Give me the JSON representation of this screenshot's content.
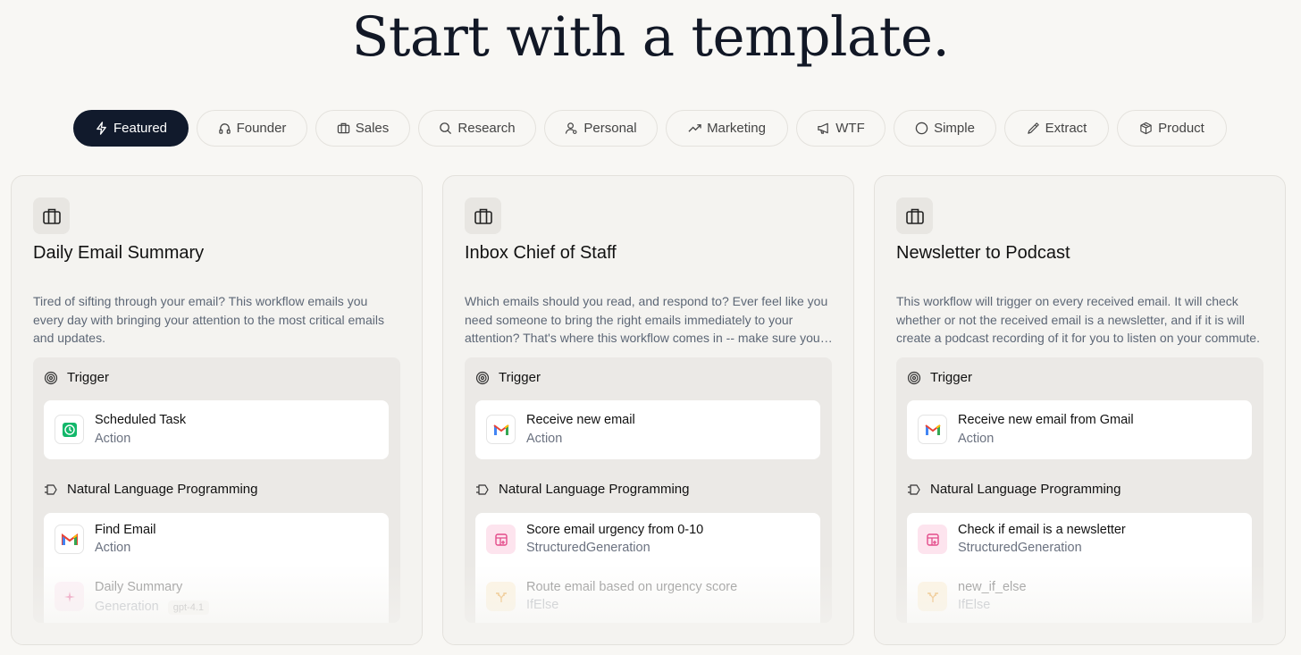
{
  "page": {
    "title": "Start with a template."
  },
  "tabs": [
    {
      "label": "Featured",
      "icon": "lightning-icon",
      "active": true
    },
    {
      "label": "Founder",
      "icon": "headphones-icon"
    },
    {
      "label": "Sales",
      "icon": "briefcase-icon"
    },
    {
      "label": "Research",
      "icon": "search-icon"
    },
    {
      "label": "Personal",
      "icon": "user-icon"
    },
    {
      "label": "Marketing",
      "icon": "trend-icon"
    },
    {
      "label": "WTF",
      "icon": "megaphone-icon"
    },
    {
      "label": "Simple",
      "icon": "circle-icon"
    },
    {
      "label": "Extract",
      "icon": "pipette-icon"
    },
    {
      "label": "Product",
      "icon": "box-icon"
    }
  ],
  "cards": [
    {
      "title": "Daily Email Summary",
      "description": "Tired of sifting through your email? This workflow emails you every day with bringing your attention to the most critical emails and updates.",
      "trigger_label": "Trigger",
      "trigger": {
        "name": "Scheduled Task",
        "type": "Action",
        "icon": "clock-icon"
      },
      "nlp_label": "Natural Language Programming",
      "steps": [
        {
          "name": "Find Email",
          "type": "Action",
          "icon": "gmail-icon"
        },
        {
          "name": "Daily Summary",
          "type": "Generation",
          "badge": "gpt-4.1",
          "icon": "sparkle-icon"
        }
      ]
    },
    {
      "title": "Inbox Chief of Staff",
      "description": "Which emails should you read, and respond to? Ever feel like you need someone to bring the right emails immediately to your attention? That's where this workflow comes in -- make sure you never miss an important email again.",
      "trigger_label": "Trigger",
      "trigger": {
        "name": "Receive new email",
        "type": "Action",
        "icon": "gmail-icon"
      },
      "nlp_label": "Natural Language Programming",
      "steps": [
        {
          "name": "Score email urgency from 0-10",
          "type": "StructuredGeneration",
          "icon": "table-icon"
        },
        {
          "name": "Route email based on urgency score",
          "type": "IfElse",
          "icon": "split-icon"
        }
      ]
    },
    {
      "title": "Newsletter to Podcast",
      "description": "This workflow will trigger on every received email. It will check whether or not the received email is a newsletter, and if it is will create a podcast recording of it for you to listen on your commute.",
      "trigger_label": "Trigger",
      "trigger": {
        "name": "Receive new email from Gmail",
        "type": "Action",
        "icon": "gmail-icon"
      },
      "nlp_label": "Natural Language Programming",
      "steps": [
        {
          "name": "Check if email is a newsletter",
          "type": "StructuredGeneration",
          "icon": "table-icon"
        },
        {
          "name": "new_if_else",
          "type": "IfElse",
          "icon": "split-icon"
        }
      ]
    }
  ],
  "colors": {
    "background": "#f8f7f4",
    "active_tab": "#111a2c",
    "card": "#f4f3f0",
    "muted_text": "#5d6776",
    "gmail_red": "#ea4335",
    "structured_pink": "#e34b8a",
    "scheduled_green": "#12b76a"
  }
}
